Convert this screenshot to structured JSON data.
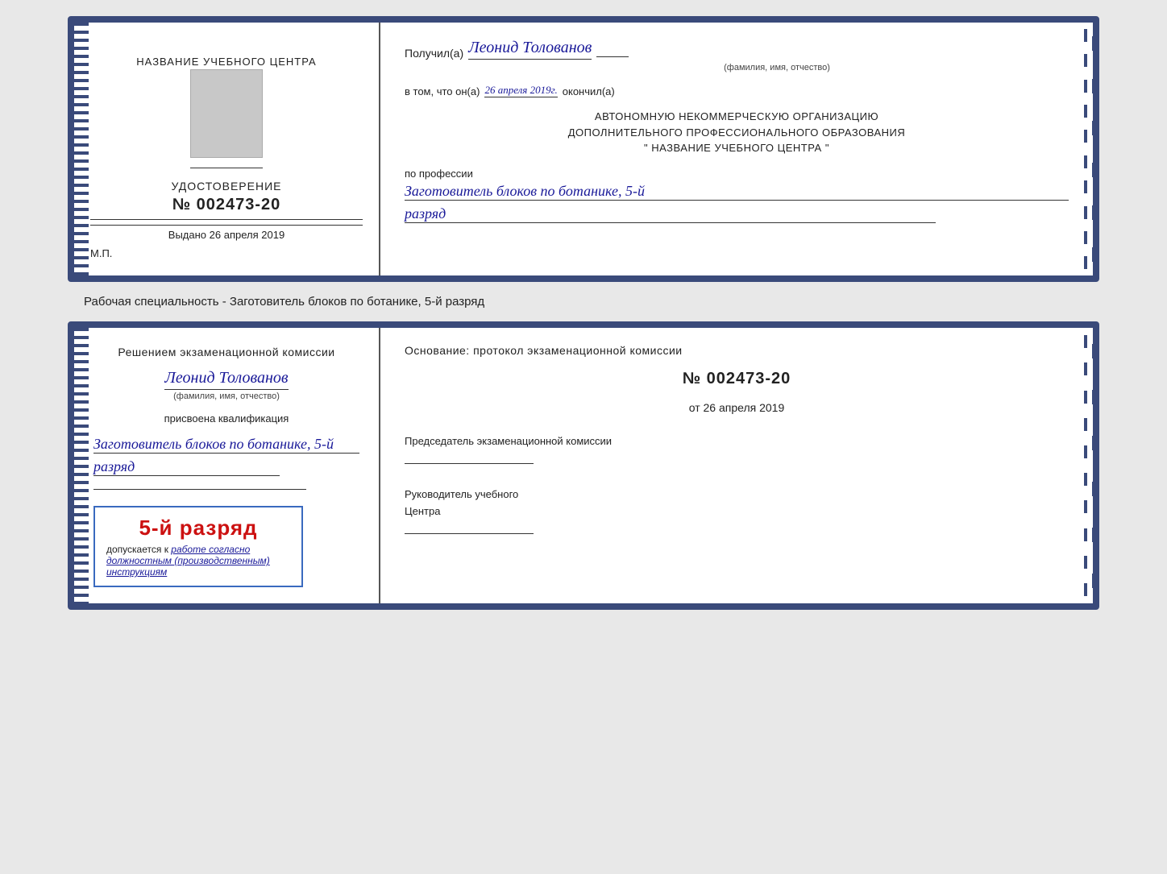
{
  "page": {
    "specialty_label": "Рабочая специальность - Заготовитель блоков по ботанике, 5-й разряд"
  },
  "card1": {
    "left": {
      "center_label": "НАЗВАНИЕ УЧЕБНОГО ЦЕНТРА",
      "cert_title": "УДОСТОВЕРЕНИЕ",
      "cert_number": "№ 002473-20",
      "issued_label": "Выдано 26 апреля 2019",
      "mp": "М.П."
    },
    "right": {
      "received_prefix": "Получил(а)",
      "recipient_name": "Леонид Толованов",
      "fio_hint": "(фамилия, имя, отчество)",
      "in_that_prefix": "в том, что он(а)",
      "date_completed": "26 апреля 2019г.",
      "finished_suffix": "окончил(а)",
      "org_line1": "АВТОНОМНУЮ НЕКОММЕРЧЕСКУЮ ОРГАНИЗАЦИЮ",
      "org_line2": "ДОПОЛНИТЕЛЬНОГО ПРОФЕССИОНАЛЬНОГО ОБРАЗОВАНИЯ",
      "org_line3": "\"  НАЗВАНИЕ УЧЕБНОГО ЦЕНТРА  \"",
      "profession_prefix": "по профессии",
      "profession_name": "Заготовитель блоков по ботанике, 5-й",
      "rank": "разряд"
    }
  },
  "card2": {
    "left": {
      "decision_line1": "Решением экзаменационной комиссии",
      "person_name": "Леонид Толованов",
      "fio_hint": "(фамилия, имя, отчество)",
      "assigned_label": "присвоена квалификация",
      "qualification_name": "Заготовитель блоков по ботанике, 5-й",
      "rank": "разряд",
      "stamp_rank": "5-й разряд",
      "stamp_allowed": "допускается к",
      "stamp_italic": "работе согласно должностным (производственным) инструкциям"
    },
    "right": {
      "basis_title": "Основание: протокол экзаменационной комиссии",
      "protocol_number": "№  002473-20",
      "protocol_date_prefix": "от",
      "protocol_date": "26 апреля 2019",
      "chairman_label": "Председатель экзаменационной комиссии",
      "head_label1": "Руководитель учебного",
      "head_label2": "Центра"
    }
  }
}
